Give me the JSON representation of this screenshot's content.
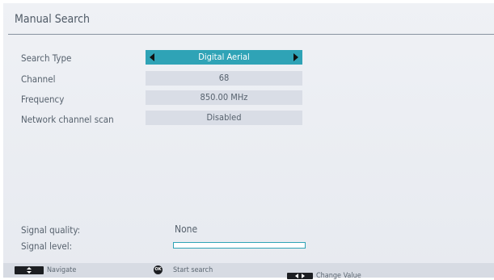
{
  "title": "Manual Search",
  "rows": [
    {
      "label": "Search Type",
      "value": "Digital Aerial"
    },
    {
      "label": "Channel",
      "value": "68"
    },
    {
      "label": "Frequency",
      "value": "850.00 MHz"
    },
    {
      "label": "Network channel scan",
      "value": "Disabled"
    }
  ],
  "signal": {
    "quality_label": "Signal quality:",
    "quality_value": "None",
    "level_label": "Signal level:",
    "level_fraction": 0
  },
  "footer": {
    "navigate": "Navigate",
    "start_search": "Start search",
    "ok_key": "OK",
    "change_value": "Change Value"
  },
  "colors": {
    "accent": "#2fa3b6",
    "panel": "#eceff4",
    "value_bg": "#d9dde6"
  }
}
